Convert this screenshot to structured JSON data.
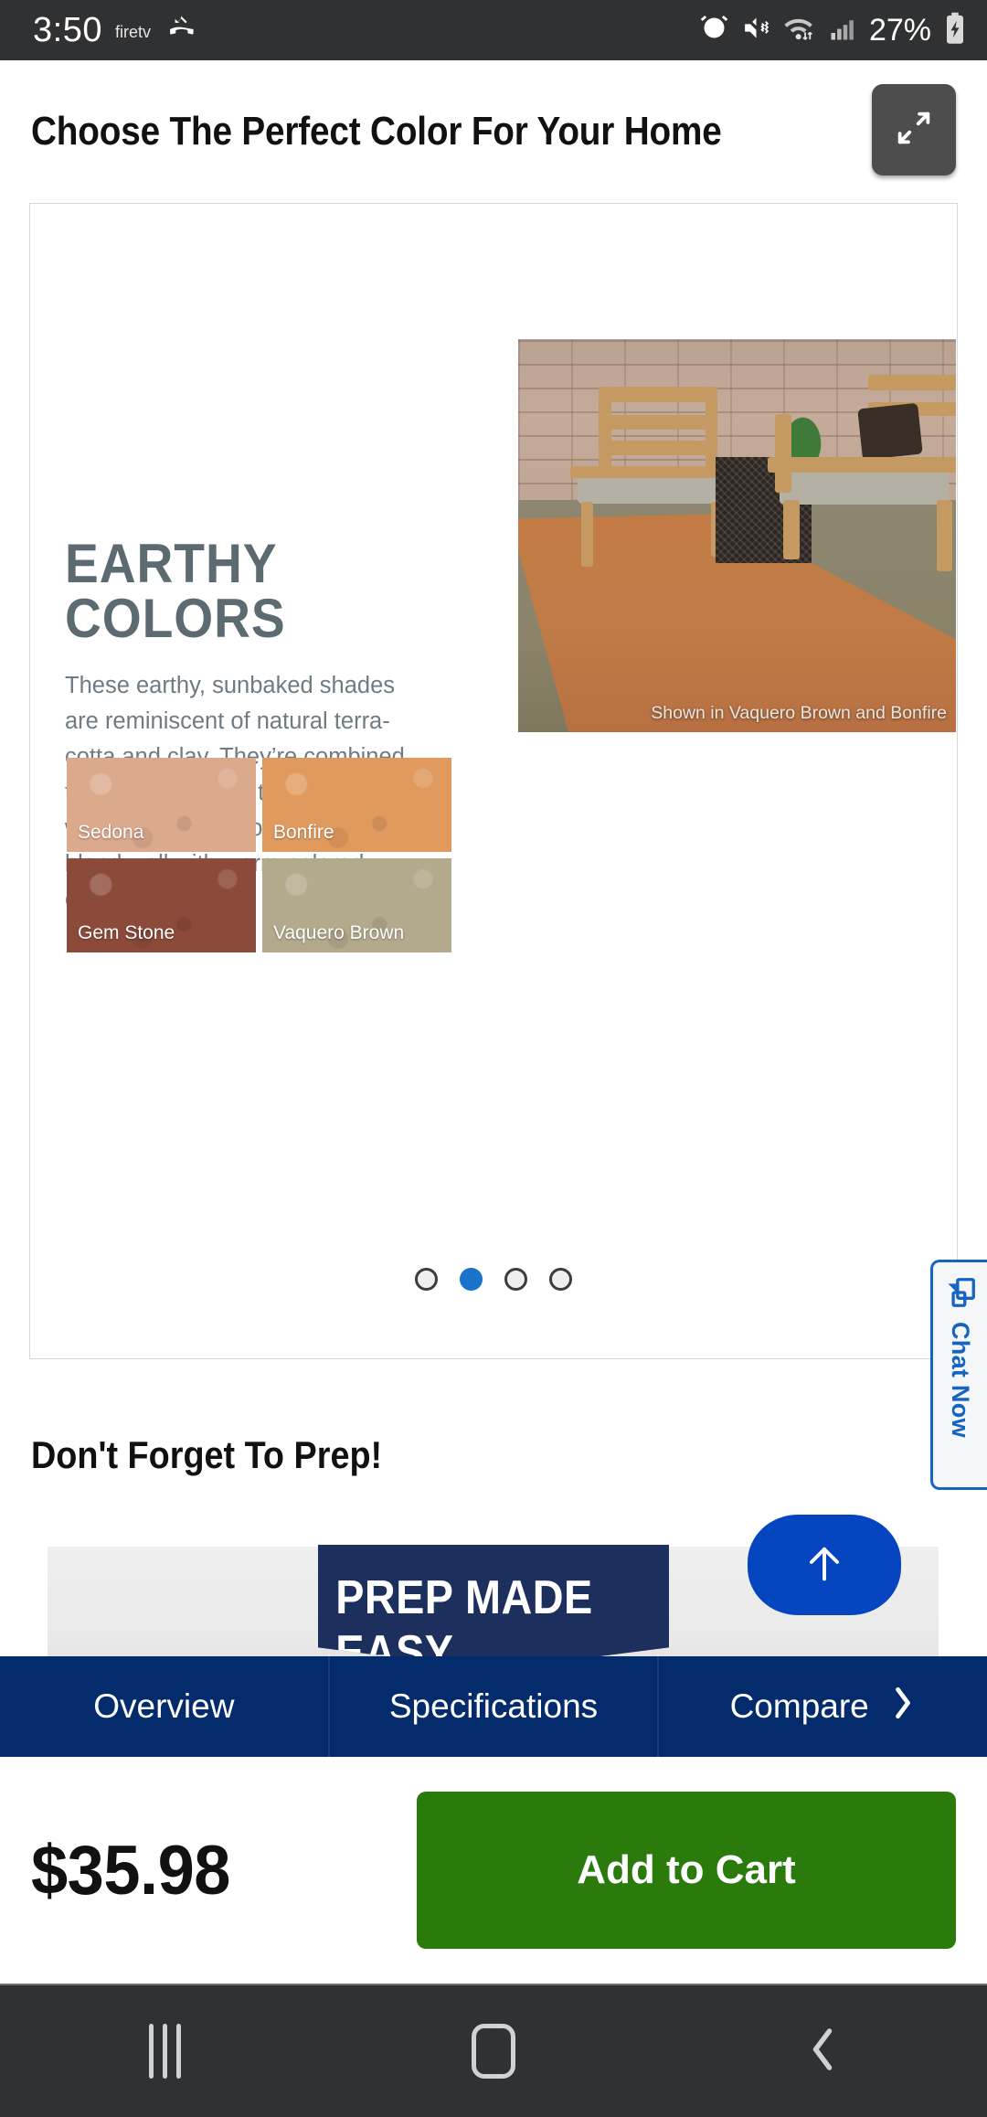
{
  "statusbar": {
    "time": "3:50",
    "brand": "firetv",
    "battery_percent": "27%",
    "icons": [
      "missed-call-icon",
      "alarm-icon",
      "mute-vibrate-icon",
      "wifi-icon",
      "signal-icon",
      "battery-charging-icon"
    ]
  },
  "header": {
    "title": "Choose The Perfect Color For Your Home",
    "expand_button": "expand-icon"
  },
  "carousel": {
    "slide": {
      "heading": "EARTHY COLORS",
      "body": "These earthy, sunbaked shades are reminiscent of natural terra-cotta and clay. They’re combined to create a palette that radiates warmth. These soothing shades blend well with warm-colored exteriors.",
      "photo_caption": "Shown in Vaquero Brown and Bonfire",
      "swatches": [
        {
          "name": "Sedona",
          "color": "#dba98c"
        },
        {
          "name": "Bonfire",
          "color": "#e09a5e"
        },
        {
          "name": "Gem Stone",
          "color": "#8c4a3a"
        },
        {
          "name": "Vaquero Brown",
          "color": "#b3a98c"
        }
      ]
    },
    "dots": {
      "count": 4,
      "active_index": 1,
      "active_color": "#1a73c8",
      "inactive_color": "#efefef"
    }
  },
  "chat": {
    "label": "Chat Now",
    "icon": "chat-bubble-icon",
    "color": "#1565c0"
  },
  "prep": {
    "heading": "Don't Forget To Prep!",
    "banner_text": "PREP MADE EASY",
    "banner_color": "#1d2f5c",
    "scroll_top_icon": "arrow-up-icon",
    "scroll_top_color": "#0546c0"
  },
  "tabs": {
    "bar_color": "#042b6b",
    "items": [
      {
        "label": "Overview"
      },
      {
        "label": "Specifications"
      },
      {
        "label": "Compare"
      }
    ],
    "chevron": "chevron-right-icon"
  },
  "purchase": {
    "price": "$35.98",
    "add_to_cart_label": "Add to Cart",
    "add_to_cart_color": "#2a7a0c"
  },
  "navbar": {
    "recents": "recents-icon",
    "home": "home-icon",
    "back": "back-icon"
  }
}
